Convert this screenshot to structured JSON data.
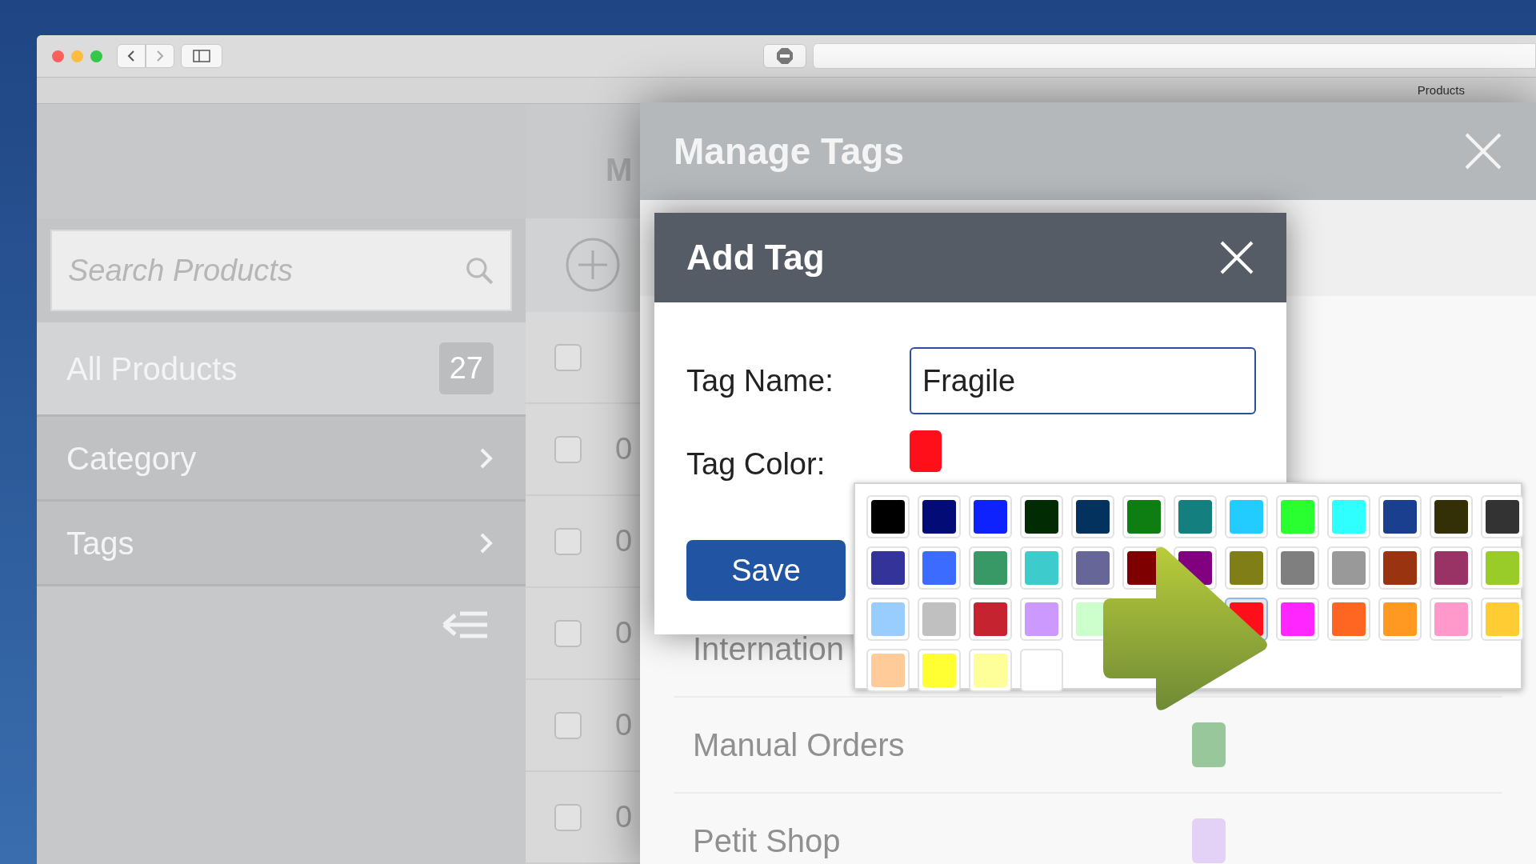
{
  "browser": {
    "tab_title": "Products"
  },
  "page": {
    "title_partial": "M"
  },
  "sidebar": {
    "search": {
      "placeholder": "Search Products"
    },
    "items": [
      {
        "label": "All Products",
        "count": "27",
        "selected": true,
        "kind": "count"
      },
      {
        "label": "Category",
        "selected": false,
        "kind": "submenu"
      },
      {
        "label": "Tags",
        "selected": false,
        "kind": "submenu"
      }
    ]
  },
  "list_rows": [
    {
      "text": "",
      "checked": false
    },
    {
      "text": "0",
      "checked": false
    },
    {
      "text": "0",
      "checked": false
    },
    {
      "text": "0",
      "checked": false
    },
    {
      "text": "0",
      "checked": false
    },
    {
      "text": "0",
      "checked": false
    }
  ],
  "manage_tags": {
    "title": "Manage Tags",
    "tags": [
      {
        "name": "Internation"
      },
      {
        "name": "Manual Orders",
        "color": "#97c79a"
      },
      {
        "name": "Petit Shop",
        "color": "#e3d1f6"
      }
    ]
  },
  "add_tag": {
    "title": "Add Tag",
    "name_label": "Tag Name:",
    "name_value": "Fragile",
    "color_label": "Tag Color:",
    "color": "#ff0f1a",
    "save": "Save"
  },
  "palette": {
    "rows": [
      [
        {
          "color": "#000000",
          "selected": false
        },
        {
          "color": "#020b76",
          "selected": false
        },
        {
          "color": "#0d22fd",
          "selected": false
        },
        {
          "color": "#012b02",
          "selected": false
        },
        {
          "color": "#04325f",
          "selected": false
        },
        {
          "color": "#0f7e12",
          "selected": false
        },
        {
          "color": "#147f7f",
          "selected": false
        },
        {
          "color": "#22ccff",
          "selected": false
        },
        {
          "color": "#2aff2f",
          "selected": false
        },
        {
          "color": "#30ffff",
          "selected": false
        },
        {
          "color": "#1b3f8f",
          "selected": false
        },
        {
          "color": "#332f06",
          "selected": false
        },
        {
          "color": "#333333",
          "selected": false
        }
      ],
      [
        {
          "color": "#333399",
          "selected": false
        },
        {
          "color": "#3b6cff",
          "selected": false
        },
        {
          "color": "#389966",
          "selected": false
        },
        {
          "color": "#3dcccb",
          "selected": false
        },
        {
          "color": "#666699",
          "selected": false
        },
        {
          "color": "#7f0000",
          "selected": false
        },
        {
          "color": "#800080",
          "selected": false
        },
        {
          "color": "#807f17",
          "selected": false
        },
        {
          "color": "#7f7f7f",
          "selected": false
        },
        {
          "color": "#999999",
          "selected": false
        },
        {
          "color": "#993310",
          "selected": false
        },
        {
          "color": "#993366",
          "selected": false
        },
        {
          "color": "#99cc29",
          "selected": false
        }
      ],
      [
        {
          "color": "#99ccff",
          "selected": false
        },
        {
          "color": "#c0c0c0",
          "selected": false
        },
        {
          "color": "#c4232f",
          "selected": false
        },
        {
          "color": "#cc99ff",
          "selected": false
        },
        {
          "color": "#ccffcc",
          "selected": false
        },
        {
          "color": "#ff0f1a",
          "selected": true
        },
        {
          "color": "#ff26ff",
          "selected": false
        },
        {
          "color": "#ff6622",
          "selected": false
        },
        {
          "color": "#ff9922",
          "selected": false
        },
        {
          "color": "#ff99cc",
          "selected": false
        },
        {
          "color": "#ffcc33",
          "selected": false
        }
      ],
      [
        {
          "color": "#ffcc99",
          "selected": false
        },
        {
          "color": "#ffff33",
          "selected": false
        },
        {
          "color": "#ffff99",
          "selected": false
        },
        {
          "color": "#ffffff",
          "selected": false
        }
      ]
    ]
  }
}
